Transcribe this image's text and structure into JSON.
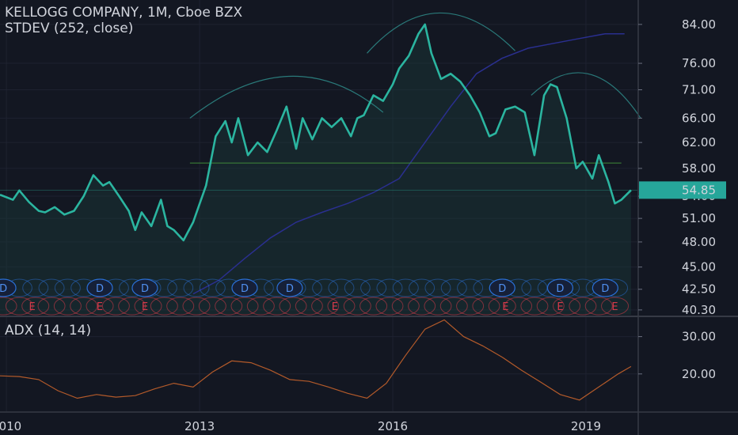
{
  "header": {
    "title": "KELLOGG COMPANY, 1M, Cboe BZX",
    "indicator": "STDEV (252, close)",
    "adx_label": "ADX (14, 14)"
  },
  "colors": {
    "background": "#131722",
    "price_line": "#2bb5a0",
    "price_fill": "#1b3a3a",
    "overlay_line": "#2a2f8f",
    "arc": "#2a7a7a",
    "neckline": "#3f8a3a",
    "adx_line": "#b35a2a",
    "dividend": "#2a6fd6",
    "earnings": "#d63a4a",
    "current_price_badge": "#26a69a",
    "grid": "#1e2230"
  },
  "chart_data": [
    {
      "type": "line",
      "name": "price",
      "y_scale": "log",
      "ylim": [
        39.8,
        88
      ],
      "xlim": [
        2009.9,
        2019.8
      ],
      "y_ticks": [
        "84.00",
        "76.00",
        "71.00",
        "66.00",
        "62.00",
        "58.00",
        "54.00",
        "51.00",
        "48.00",
        "45.00",
        "42.50",
        "40.30"
      ],
      "current_price": "54.85",
      "neckline": 58.8,
      "series": [
        {
          "x": [
            2009.9,
            2010.1,
            2010.2,
            2010.35,
            2010.5,
            2010.6,
            2010.75,
            2010.9,
            2011.05,
            2011.2,
            2011.35,
            2011.5,
            2011.6,
            2011.75,
            2011.9,
            2012.0,
            2012.1,
            2012.25,
            2012.4,
            2012.5,
            2012.6,
            2012.75,
            2012.9,
            2013.1,
            2013.25,
            2013.4,
            2013.5,
            2013.6,
            2013.75,
            2013.9,
            2014.05,
            2014.2,
            2014.35,
            2014.5,
            2014.6,
            2014.75,
            2014.9,
            2015.05,
            2015.2,
            2015.35,
            2015.45,
            2015.55,
            2015.7,
            2015.85,
            2016.0,
            2016.1,
            2016.25,
            2016.4,
            2016.5,
            2016.6,
            2016.75,
            2016.9,
            2017.05,
            2017.2,
            2017.35,
            2017.5,
            2017.6,
            2017.75,
            2017.9,
            2018.05,
            2018.2,
            2018.35,
            2018.45,
            2018.55,
            2018.7,
            2018.85,
            2018.95,
            2019.1,
            2019.2,
            2019.35,
            2019.45,
            2019.55,
            2019.7
          ],
          "y": [
            54.2,
            53.5,
            54.8,
            53.2,
            52.0,
            51.8,
            52.5,
            51.5,
            52.0,
            54.0,
            57.0,
            55.5,
            56.0,
            54.0,
            52.0,
            49.5,
            51.8,
            50.0,
            53.5,
            50.0,
            49.5,
            48.2,
            50.5,
            55.5,
            63.0,
            65.5,
            62.0,
            66.0,
            60.0,
            62.0,
            60.5,
            64.0,
            68.0,
            61.0,
            66.0,
            62.5,
            66.0,
            64.5,
            66.0,
            63.0,
            66.0,
            66.5,
            70.0,
            69.0,
            72.0,
            75.0,
            77.5,
            82.0,
            84.0,
            78.0,
            73.0,
            74.0,
            72.5,
            70.0,
            67.0,
            63.0,
            63.5,
            67.5,
            68.0,
            67.0,
            60.0,
            70.0,
            72.0,
            71.5,
            66.0,
            58.0,
            59.0,
            56.5,
            60.0,
            56.0,
            53.0,
            53.5,
            54.85
          ]
        },
        {
          "x": [
            2012.9,
            2013.3,
            2013.7,
            2014.1,
            2014.5,
            2014.9,
            2015.3,
            2015.7,
            2016.1,
            2016.5,
            2016.9,
            2017.3,
            2017.7,
            2018.1,
            2018.5,
            2018.9,
            2019.3,
            2019.6
          ],
          "y": [
            42.0,
            43.5,
            46.0,
            48.5,
            50.5,
            51.8,
            53.0,
            54.5,
            56.5,
            62.0,
            68.0,
            74.0,
            77.0,
            79.0,
            80.0,
            81.0,
            82.0,
            82.0
          ]
        }
      ],
      "events": {
        "dividends_x": [
          2009.95,
          2011.45,
          2012.15,
          2013.7,
          2014.4,
          2017.7,
          2018.6,
          2019.3
        ],
        "dividend_label": "D",
        "earnings_label": "E",
        "earnings_labeled_x": [
          2010.4,
          2011.45,
          2012.15,
          2015.1,
          2017.75,
          2018.6,
          2019.45
        ]
      }
    },
    {
      "type": "line",
      "name": "adx",
      "ylim": [
        10,
        35
      ],
      "y_ticks": [
        "30.00",
        "20.00"
      ],
      "x": [
        2009.9,
        2010.2,
        2010.5,
        2010.8,
        2011.1,
        2011.4,
        2011.7,
        2012.0,
        2012.3,
        2012.6,
        2012.9,
        2013.2,
        2013.5,
        2013.8,
        2014.1,
        2014.4,
        2014.7,
        2015.0,
        2015.3,
        2015.6,
        2015.9,
        2016.2,
        2016.5,
        2016.8,
        2017.1,
        2017.4,
        2017.7,
        2018.0,
        2018.3,
        2018.6,
        2018.9,
        2019.2,
        2019.5,
        2019.7
      ],
      "y": [
        19.5,
        19.3,
        18.5,
        15.5,
        13.5,
        14.5,
        13.8,
        14.2,
        16.0,
        17.5,
        16.5,
        20.5,
        23.5,
        23.0,
        21.0,
        18.5,
        18.0,
        16.5,
        14.8,
        13.5,
        17.5,
        25.0,
        32.0,
        34.5,
        30.0,
        27.5,
        24.5,
        21.0,
        17.8,
        14.5,
        13.0,
        16.5,
        20.0,
        22.0
      ],
      "time_ticks": [
        {
          "x": 2010.0,
          "label": "2010"
        },
        {
          "x": 2013.0,
          "label": "2013"
        },
        {
          "x": 2016.0,
          "label": "2016"
        },
        {
          "x": 2019.0,
          "label": "2019"
        }
      ]
    }
  ]
}
